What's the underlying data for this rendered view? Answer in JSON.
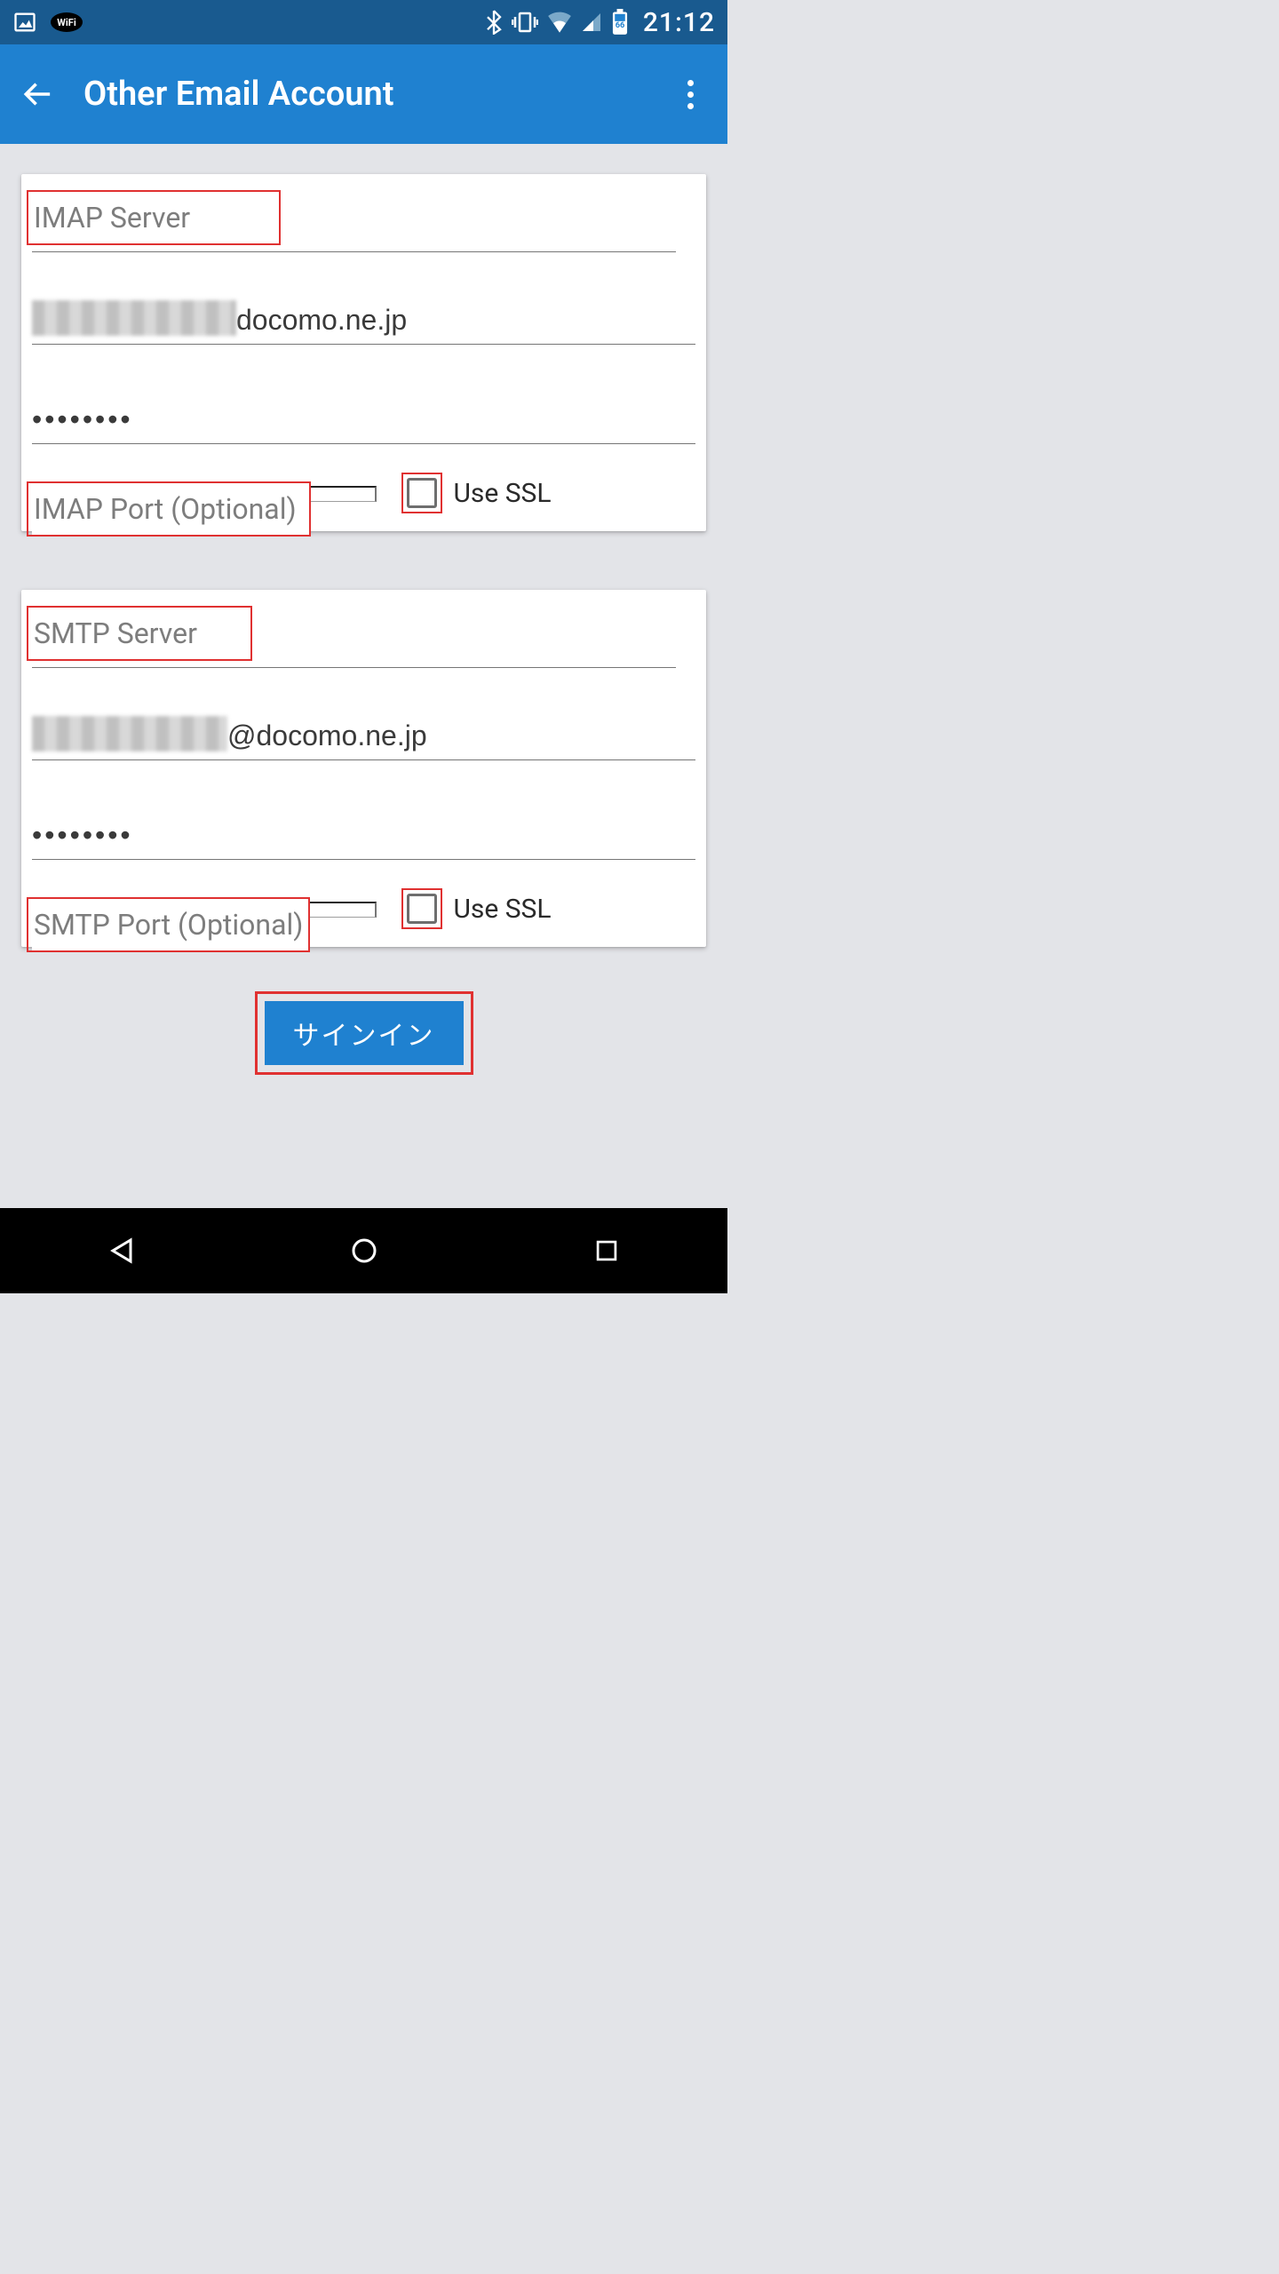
{
  "statusbar": {
    "battery_level": "66",
    "clock": "21:12"
  },
  "appbar": {
    "title": "Other Email Account"
  },
  "imap": {
    "server_placeholder": "IMAP Server",
    "username_suffix": "docomo.ne.jp",
    "password_mask": "••••••••",
    "port_placeholder": "IMAP Port (Optional)",
    "ssl_label": "Use SSL"
  },
  "smtp": {
    "server_placeholder": "SMTP Server",
    "username_suffix": "@docomo.ne.jp",
    "password_mask": "••••••••",
    "port_placeholder": "SMTP Port (Optional)",
    "ssl_label": "Use SSL"
  },
  "signin": {
    "label": "サインイン"
  }
}
